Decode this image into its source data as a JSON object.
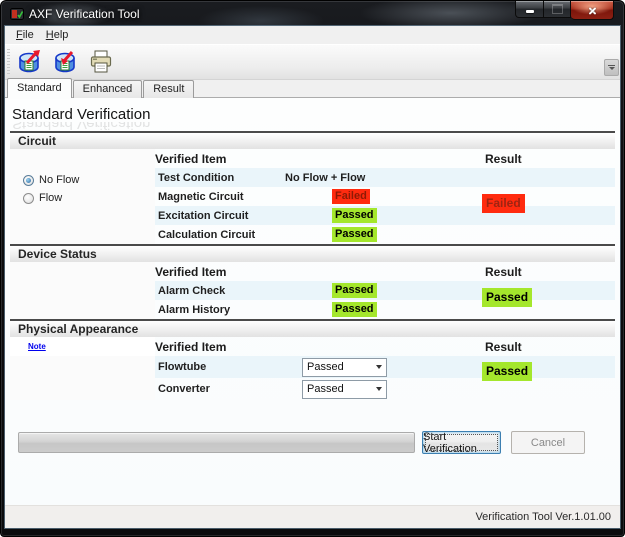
{
  "window": {
    "title": "AXF Verification Tool",
    "caption_buttons": [
      "minimize",
      "maximize",
      "close"
    ]
  },
  "menu": {
    "items": [
      {
        "label": "File"
      },
      {
        "label": "Help"
      }
    ]
  },
  "toolbar": {
    "icons": [
      "export-data-icon",
      "import-data-icon",
      "print-icon"
    ]
  },
  "tabs": [
    {
      "label": "Standard",
      "active": true
    },
    {
      "label": "Enhanced",
      "active": false
    },
    {
      "label": "Result",
      "active": false
    }
  ],
  "page": {
    "heading": "Standard Verification",
    "sections": [
      {
        "title": "Circuit",
        "columns": {
          "item": "Verified Item",
          "result": "Result"
        },
        "radios": [
          {
            "label": "No Flow",
            "selected": true
          },
          {
            "label": "Flow",
            "selected": false
          }
        ],
        "rows": [
          {
            "item": "Test Condition",
            "value": "No Flow + Flow"
          },
          {
            "item": "Magnetic Circuit",
            "badge": "Failed",
            "badge_type": "failed"
          },
          {
            "item": "Excitation Circuit",
            "badge": "Passed",
            "badge_type": "passed"
          },
          {
            "item": "Calculation Circuit",
            "badge": "Passed",
            "badge_type": "passed"
          }
        ],
        "overall": "Failed",
        "overall_type": "failed"
      },
      {
        "title": "Device Status",
        "columns": {
          "item": "Verified Item",
          "result": "Result"
        },
        "rows": [
          {
            "item": "Alarm Check",
            "badge": "Passed",
            "badge_type": "passed"
          },
          {
            "item": "Alarm History",
            "badge": "Passed",
            "badge_type": "passed"
          }
        ],
        "overall": "Passed",
        "overall_type": "passed"
      },
      {
        "title": "Physical Appearance",
        "note_label": "Note",
        "columns": {
          "item": "Verified Item",
          "result": "Result"
        },
        "rows": [
          {
            "item": "Flowtube",
            "select_value": "Passed"
          },
          {
            "item": "Converter",
            "select_value": "Passed"
          }
        ],
        "overall": "Passed",
        "overall_type": "passed"
      }
    ]
  },
  "footer": {
    "progress_percent": 0,
    "start_label": "Start Verification",
    "cancel_label": "Cancel",
    "cancel_enabled": false
  },
  "statusbar": {
    "version": "Verification Tool Ver.1.01.00"
  },
  "colors": {
    "passed_bg": "#A4E72C",
    "failed_bg": "#FF2B0F",
    "failed_text": "#8E1A05",
    "focus_border": "#3C7FB1",
    "link": "#0000EE"
  }
}
